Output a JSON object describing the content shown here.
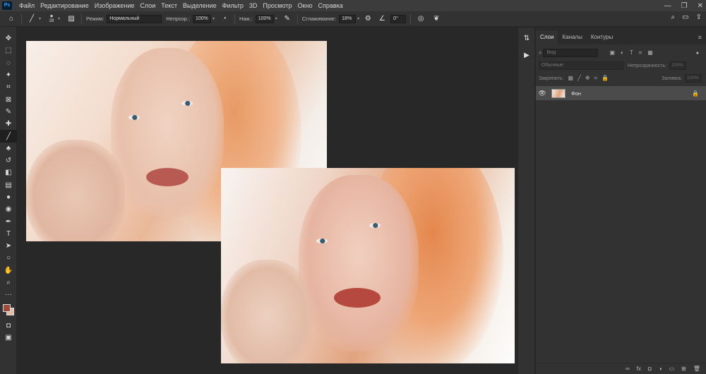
{
  "menubar": {
    "logo": "Ps",
    "items": [
      "Файл",
      "Редактирование",
      "Изображение",
      "Слои",
      "Текст",
      "Выделение",
      "Фильтр",
      "3D",
      "Просмотр",
      "Окно",
      "Справка"
    ],
    "controls": [
      "—",
      "❐",
      "✕"
    ]
  },
  "options": {
    "brush_size": "28",
    "mode_label": "Режим:",
    "mode_value": "Нормальный",
    "opacity_label": "Непрозр.:",
    "opacity_value": "100%",
    "pressure_label": "Наж.:",
    "pressure_value": "100%",
    "smoothing_label": "Сглаживание:",
    "smoothing_value": "18%",
    "angle_value": "0°"
  },
  "toolbar": {
    "tools": [
      "move-tool",
      "marquee-tool",
      "lasso-tool",
      "magic-wand-tool",
      "crop-tool",
      "frame-tool",
      "eyedropper-tool",
      "healing-tool",
      "brush-tool",
      "stamp-tool",
      "history-brush-tool",
      "eraser-tool",
      "gradient-tool",
      "blur-tool",
      "dodge-tool",
      "pen-tool",
      "type-tool",
      "path-select-tool",
      "ellipse-tool",
      "hand-tool",
      "zoom-tool",
      "more-tools"
    ],
    "glyphs": [
      "✥",
      "⬚",
      "◌",
      "✦",
      "⌗",
      "⊠",
      "✎",
      "✚",
      "╱",
      "♣",
      "↺",
      "◧",
      "▤",
      "●",
      "◉",
      "✒",
      "T",
      "➤",
      "○",
      "✋",
      "⌕",
      "···"
    ],
    "active_index": 8,
    "fg_color": "#a04a3c",
    "bg_color": "#e4b9a6"
  },
  "panel": {
    "tabs": [
      "Слои",
      "Каналы",
      "Контуры"
    ],
    "search_placeholder": "Вид",
    "filter_icons": [
      "▣",
      "◐",
      "T",
      "⌗",
      "▦"
    ],
    "blend_mode": "Обычные",
    "opacity_label": "Непрозрачность:",
    "opacity_value": "100%",
    "lock_label": "Закрепить:",
    "fill_label": "Заливка:",
    "fill_value": "100%",
    "layer_name": "Фон",
    "bottom_icons": [
      "∞",
      "fx",
      "◘",
      "◑",
      "▭",
      "⊞",
      "🗑"
    ]
  }
}
